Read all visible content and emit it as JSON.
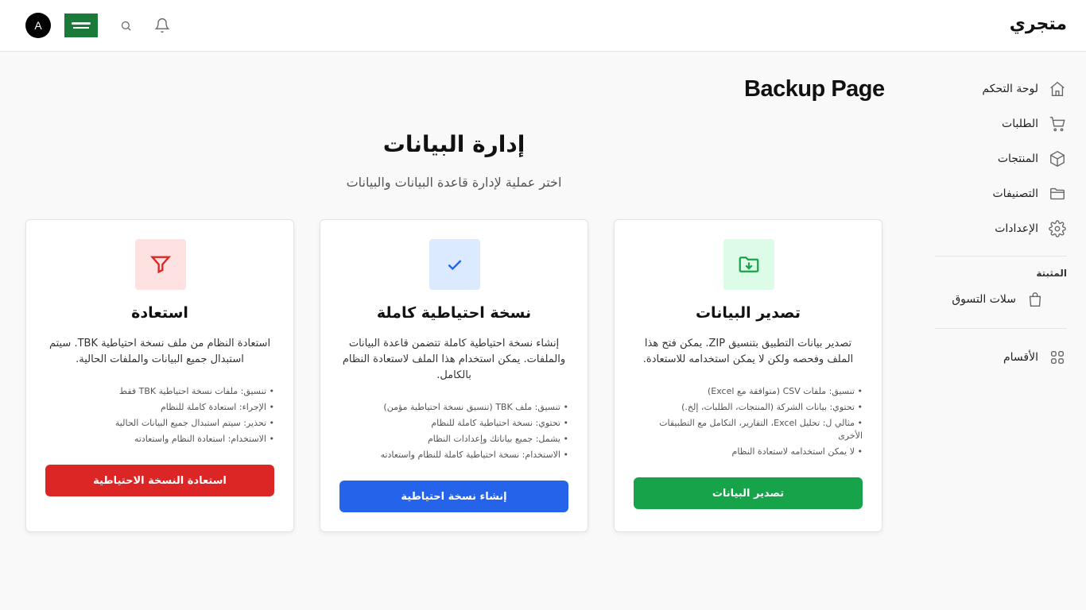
{
  "header": {
    "brand": "متجري",
    "avatar_letter": "A"
  },
  "sidebar": {
    "items": [
      {
        "label": "لوحة التحكم",
        "icon": "home-icon"
      },
      {
        "label": "الطلبات",
        "icon": "cart-icon"
      },
      {
        "label": "المنتجات",
        "icon": "box-icon"
      },
      {
        "label": "التصنيفات",
        "icon": "folder-icon"
      },
      {
        "label": "الإعدادات",
        "icon": "gear-icon"
      }
    ],
    "section_heading": "المثبتة",
    "pinned": [
      {
        "label": "سلات التسوق",
        "icon": "shopping-bag-icon"
      }
    ],
    "sections_item": {
      "label": "الأقسام",
      "icon": "grid-icon"
    }
  },
  "main": {
    "page_title": "Backup Page",
    "section_title": "إدارة البيانات",
    "section_subtitle": "اختر عملية لإدارة قاعدة البيانات والبيانات"
  },
  "cards": {
    "export": {
      "title": "تصدير البيانات",
      "description": "تصدير بيانات التطبيق بتنسيق ZIP. يمكن فتح هذا الملف وفحصه ولكن لا يمكن استخدامه للاستعادة.",
      "bullets": [
        "تنسيق: ملفات CSV (متوافقة مع Excel)",
        "تحتوي: بيانات الشركة (المنتجات، الطلبات، إلخ.)",
        "مثالي ل: تحليل Excel، التقارير، التكامل مع التطبيقات الأخرى",
        "لا يمكن استخدامه لاستعادة النظام"
      ],
      "button": "تصدير البيانات",
      "accent": "#16a34a"
    },
    "backup": {
      "title": "نسخة احتياطية كاملة",
      "description": "إنشاء نسخة احتياطية كاملة تتضمن قاعدة البيانات والملفات. يمكن استخدام هذا الملف لاستعادة النظام بالكامل.",
      "bullets": [
        "تنسيق: ملف TBK (تنسيق نسخة احتياطية مؤمن)",
        "تحتوي: نسخة احتياطية كاملة للنظام",
        "يشمل: جميع بياناتك وإعدادات النظام",
        "الاستخدام: نسخة احتياطية كاملة للنظام واستعادته"
      ],
      "button": "إنشاء نسخة احتياطية",
      "accent": "#2563eb"
    },
    "restore": {
      "title": "استعادة",
      "description": "استعادة النظام من ملف نسخة احتياطية TBK. سيتم استبدال جميع البيانات والملفات الحالية.",
      "bullets": [
        "تنسيق: ملفات نسخة احتياطية TBK فقط",
        "الإجراء: استعادة كاملة للنظام",
        "تحذير: سيتم استبدال جميع البيانات الحالية",
        "الاستخدام: استعادة النظام واستعادته"
      ],
      "button": "استعادة النسخة الاحتياطية",
      "accent": "#dc2626"
    }
  }
}
